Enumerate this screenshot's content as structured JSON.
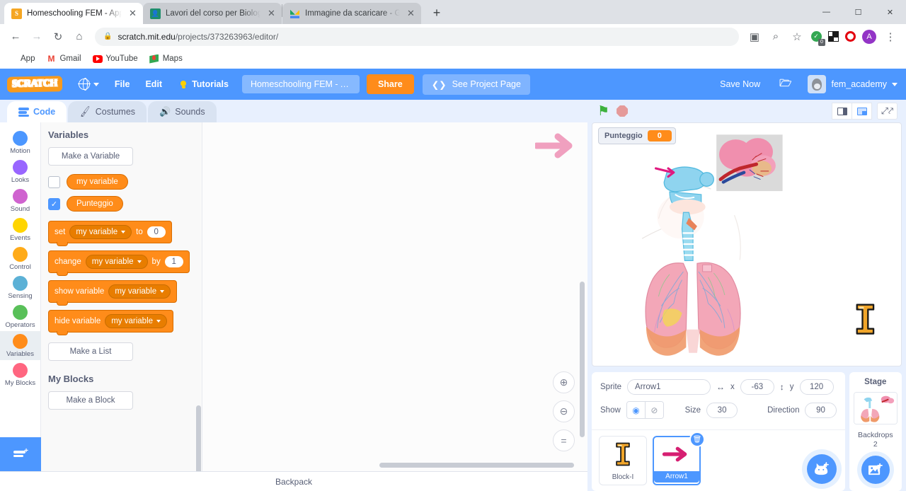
{
  "browser": {
    "tabs": [
      {
        "title": "Homeschooling FEM - Apparato",
        "favicon": "scratch-favicon",
        "active": true,
        "close_label": "✕"
      },
      {
        "title": "Lavori del corso per Biologia in ",
        "favicon": "classroom-favicon",
        "active": false,
        "close_label": "✕"
      },
      {
        "title": "Immagine da scaricare - Google ",
        "favicon": "drive-favicon",
        "active": false,
        "close_label": "✕"
      }
    ],
    "new_tab_label": "+",
    "window_controls": {
      "minimize": "—",
      "maximize": "☐",
      "close": "✕"
    },
    "nav": {
      "back": "←",
      "forward": "→",
      "reload": "↻",
      "home": "⌂"
    },
    "omnibox": {
      "lock": "🔒",
      "host": "scratch.mit.edu",
      "path": "/projects/373263963/editor/",
      "translate_icon": "translate-icon",
      "zoom_icon": "⌕",
      "star_icon": "☆",
      "extension_badge_count": "0",
      "profile_initial": "A",
      "menu_icon": "⋮"
    },
    "bookmarks": [
      {
        "label": "App",
        "icon": "apps-grid-icon"
      },
      {
        "label": "Gmail",
        "icon": "gmail-icon"
      },
      {
        "label": "YouTube",
        "icon": "youtube-icon"
      },
      {
        "label": "Maps",
        "icon": "maps-icon"
      }
    ]
  },
  "scratch_menu": {
    "logo": "SCRATCH",
    "language_label": "globe-icon",
    "items": [
      "File",
      "Edit"
    ],
    "tutorials": "Tutorials",
    "project_title": "Homeschooling FEM - Ap...",
    "share": "Share",
    "see_project_page": "See Project Page",
    "save_now": "Save Now",
    "folder_icon": "folder-icon",
    "username": "fem_academy"
  },
  "editor_tabs": [
    {
      "label": "Code",
      "icon": "code-icon",
      "active": true
    },
    {
      "label": "Costumes",
      "icon": "brush-icon",
      "active": false
    },
    {
      "label": "Sounds",
      "icon": "speaker-icon",
      "active": false
    }
  ],
  "categories": [
    {
      "label": "Motion",
      "color": "#4c97ff"
    },
    {
      "label": "Looks",
      "color": "#9966ff"
    },
    {
      "label": "Sound",
      "color": "#cf63cf"
    },
    {
      "label": "Events",
      "color": "#ffd500"
    },
    {
      "label": "Control",
      "color": "#ffab19"
    },
    {
      "label": "Sensing",
      "color": "#5cb1d6"
    },
    {
      "label": "Operators",
      "color": "#59c059"
    },
    {
      "label": "Variables",
      "color": "#ff8c1a",
      "selected": true
    },
    {
      "label": "My Blocks",
      "color": "#ff6680"
    }
  ],
  "add_extension_label": "add-extension-button",
  "palette": {
    "heading": "Variables",
    "make_variable": "Make a Variable",
    "variables": [
      {
        "name": "my variable",
        "checked": false
      },
      {
        "name": "Punteggio",
        "checked": true
      }
    ],
    "blocks": [
      {
        "id": "set",
        "pre": "set",
        "dropdown": "my variable",
        "mid": "to",
        "value": "0"
      },
      {
        "id": "change",
        "pre": "change",
        "dropdown": "my variable",
        "mid": "by",
        "value": "1"
      },
      {
        "id": "show",
        "pre": "show variable",
        "dropdown": "my variable"
      },
      {
        "id": "hide",
        "pre": "hide variable",
        "dropdown": "my variable"
      }
    ],
    "make_list": "Make a List",
    "my_blocks_heading": "My Blocks",
    "make_block": "Make a Block"
  },
  "canvas": {
    "zoom_in": "zoom-in-icon",
    "zoom_out": "zoom-out-icon",
    "zoom_reset": "=",
    "backpack": "Backpack"
  },
  "stage": {
    "green_flag": "green-flag-icon",
    "stop": "stop-icon",
    "mode_small": "small-stage-icon",
    "mode_large": "large-stage-icon",
    "mode_fullscreen": "fullscreen-icon",
    "monitor": {
      "name": "Punteggio",
      "value": "0"
    }
  },
  "sprite_info": {
    "sprite_label": "Sprite",
    "sprite_name": "Arrow1",
    "x_label": "x",
    "x_value": "-63",
    "y_label": "y",
    "y_value": "120",
    "show_label": "Show",
    "show_on_icon": "eye-icon",
    "show_off_icon": "eye-slash-icon",
    "size_label": "Size",
    "size_value": "30",
    "direction_label": "Direction",
    "direction_value": "90"
  },
  "sprites": [
    {
      "name": "Block-I",
      "selected": false,
      "thumb": "block-i-thumb"
    },
    {
      "name": "Arrow1",
      "selected": true,
      "thumb": "arrow-thumb",
      "delete_icon": "trash-icon"
    }
  ],
  "add_sprite_button": "choose-a-sprite-icon",
  "stage_panel": {
    "title": "Stage",
    "backdrops_label": "Backdrops",
    "backdrops_count": "2",
    "add_backdrop_button": "choose-a-backdrop-icon"
  },
  "colors": {
    "scratch_blue": "#4d97ff",
    "variables_orange": "#ff8c1a",
    "share_orange": "#ff8c1a"
  }
}
